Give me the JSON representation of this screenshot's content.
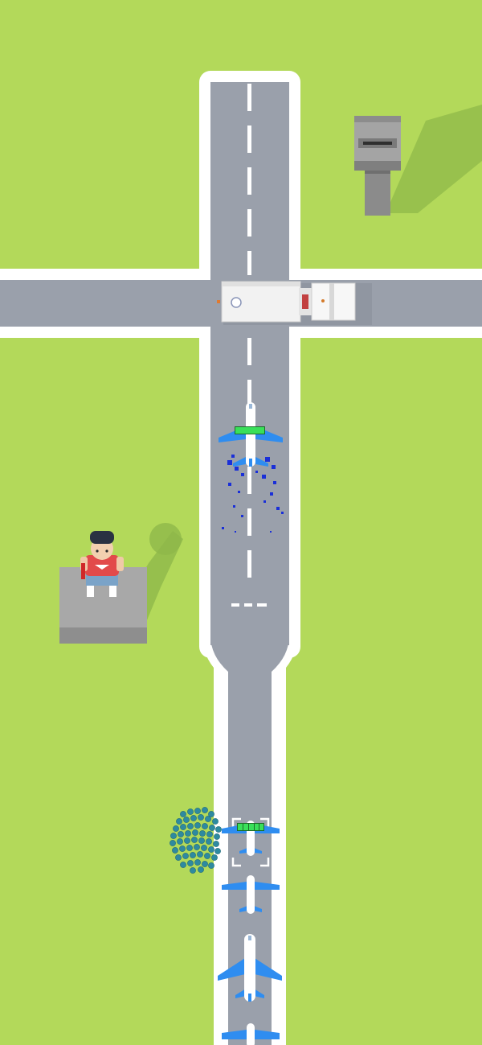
{
  "scene": {
    "type": "airport-runway-game",
    "colors": {
      "grass": "#b3d95a",
      "runway": "#9aa0ab",
      "runway_border": "#ffffff",
      "marking": "#ffffff",
      "plane_wing": "#2f8df0",
      "plane_body": "#ffffff",
      "health_bar": "#39e05a",
      "passenger": "#2e8aa0",
      "building": "#9a9a9a",
      "person_shirt": "#e24a4a",
      "person_cap": "#2a3242",
      "damage_particles": "#1a2fd8"
    }
  },
  "objects": {
    "control_tower": {
      "icon": "control-tower-icon"
    },
    "fuel_truck": {
      "icon": "truck-icon"
    },
    "flying_plane": {
      "icon": "airplane-icon",
      "health_fraction": 1.0
    },
    "ground_crew_person": {
      "icon": "person-icon"
    },
    "queued_planes": [
      {
        "icon": "airplane-icon",
        "selected": true,
        "health_segments_filled": 5,
        "health_segments_total": 5
      },
      {
        "icon": "airplane-icon",
        "selected": false
      },
      {
        "icon": "airplane-icon",
        "selected": false
      },
      {
        "icon": "airplane-icon",
        "selected": false
      }
    ],
    "passenger_crowd": {
      "icon": "passenger-crowd-icon"
    }
  }
}
